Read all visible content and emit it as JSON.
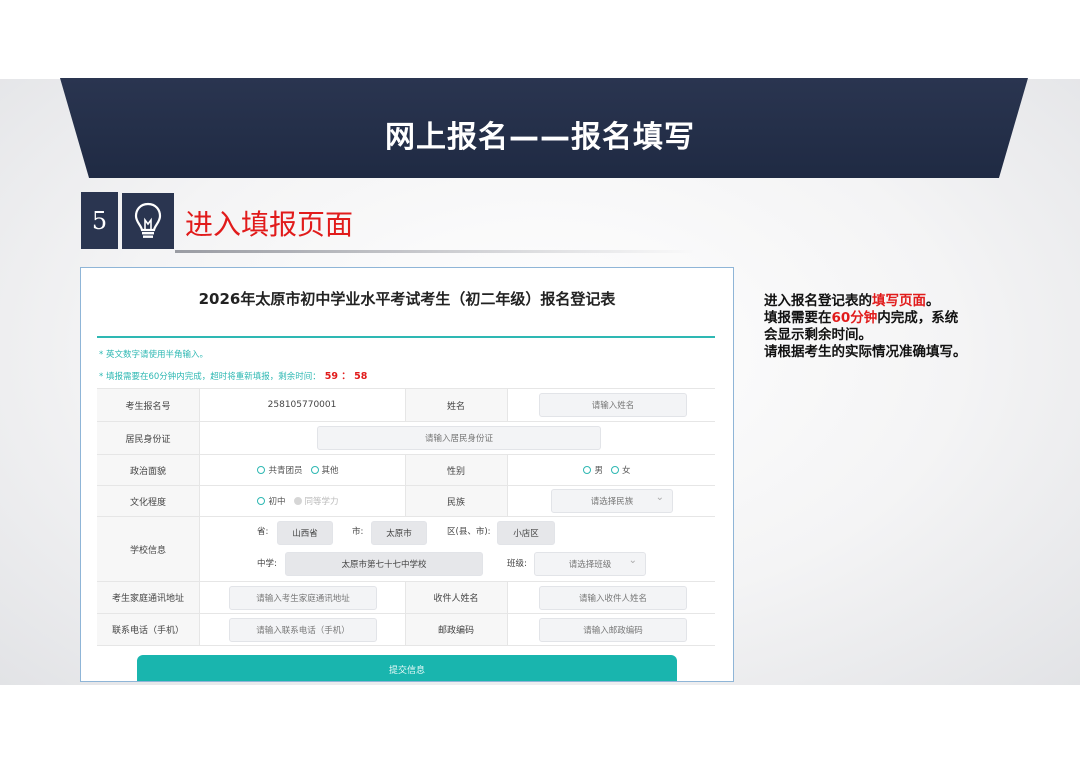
{
  "slide": {
    "title": "网上报名——报名填写",
    "step_number": "5",
    "step_title": "进入填报页面",
    "icons": {
      "step": "lightbulb-icon"
    },
    "colors": {
      "navy": "#2a3550",
      "accent_red": "#e11b1b",
      "teal": "#19b5ae"
    }
  },
  "form": {
    "title": "2026年太原市初中学业水平考试考生（初二年级）报名登记表",
    "notes": {
      "note1": "* 英文数字请使用半角输入。",
      "note2": "* 填报需要在60分钟内完成，超时将重新填报，剩余时间：",
      "timer": "59 ： 58"
    },
    "rows": {
      "reg_label": "考生报名号",
      "reg_value": "258105770001",
      "name_label": "姓名",
      "name_placeholder": "请输入姓名",
      "id_label": "居民身份证",
      "id_placeholder": "请输入居民身份证",
      "politics_label": "政治面貌",
      "politics_opt1": "共青团员",
      "politics_opt2": "其他",
      "gender_label": "性别",
      "gender_opt1": "男",
      "gender_opt2": "女",
      "edu_label": "文化程度",
      "edu_opt1": "初中",
      "edu_opt2": "同等学力",
      "ethnic_label": "民族",
      "ethnic_placeholder": "请选择民族",
      "school_label": "学校信息",
      "province_label": "省:",
      "province_value": "山西省",
      "city_label": "市:",
      "city_value": "太原市",
      "district_label": "区(县、市):",
      "district_value": "小店区",
      "school_name_label": "中学:",
      "school_name_value": "太原市第七十七中学校",
      "class_label": "班级:",
      "class_placeholder": "请选择班级",
      "address_label": "考生家庭通讯地址",
      "address_placeholder": "请输入考生家庭通讯地址",
      "recipient_label": "收件人姓名",
      "recipient_placeholder": "请输入收件人姓名",
      "phone_label": "联系电话（手机）",
      "phone_placeholder": "请输入联系电话（手机）",
      "postcode_label": "邮政编码",
      "postcode_placeholder": "请输入邮政编码"
    },
    "submit_label": "提交信息"
  },
  "description": {
    "l1_a": "进入报名登记表的",
    "l1_b": "填写页面",
    "l1_c": "。",
    "l2_a": "填报需要在",
    "l2_b": "60分钟",
    "l2_c": "内完成，系统",
    "l3": "会显示剩余时间。",
    "l4": "请根据考生的实际情况准确填写。"
  }
}
